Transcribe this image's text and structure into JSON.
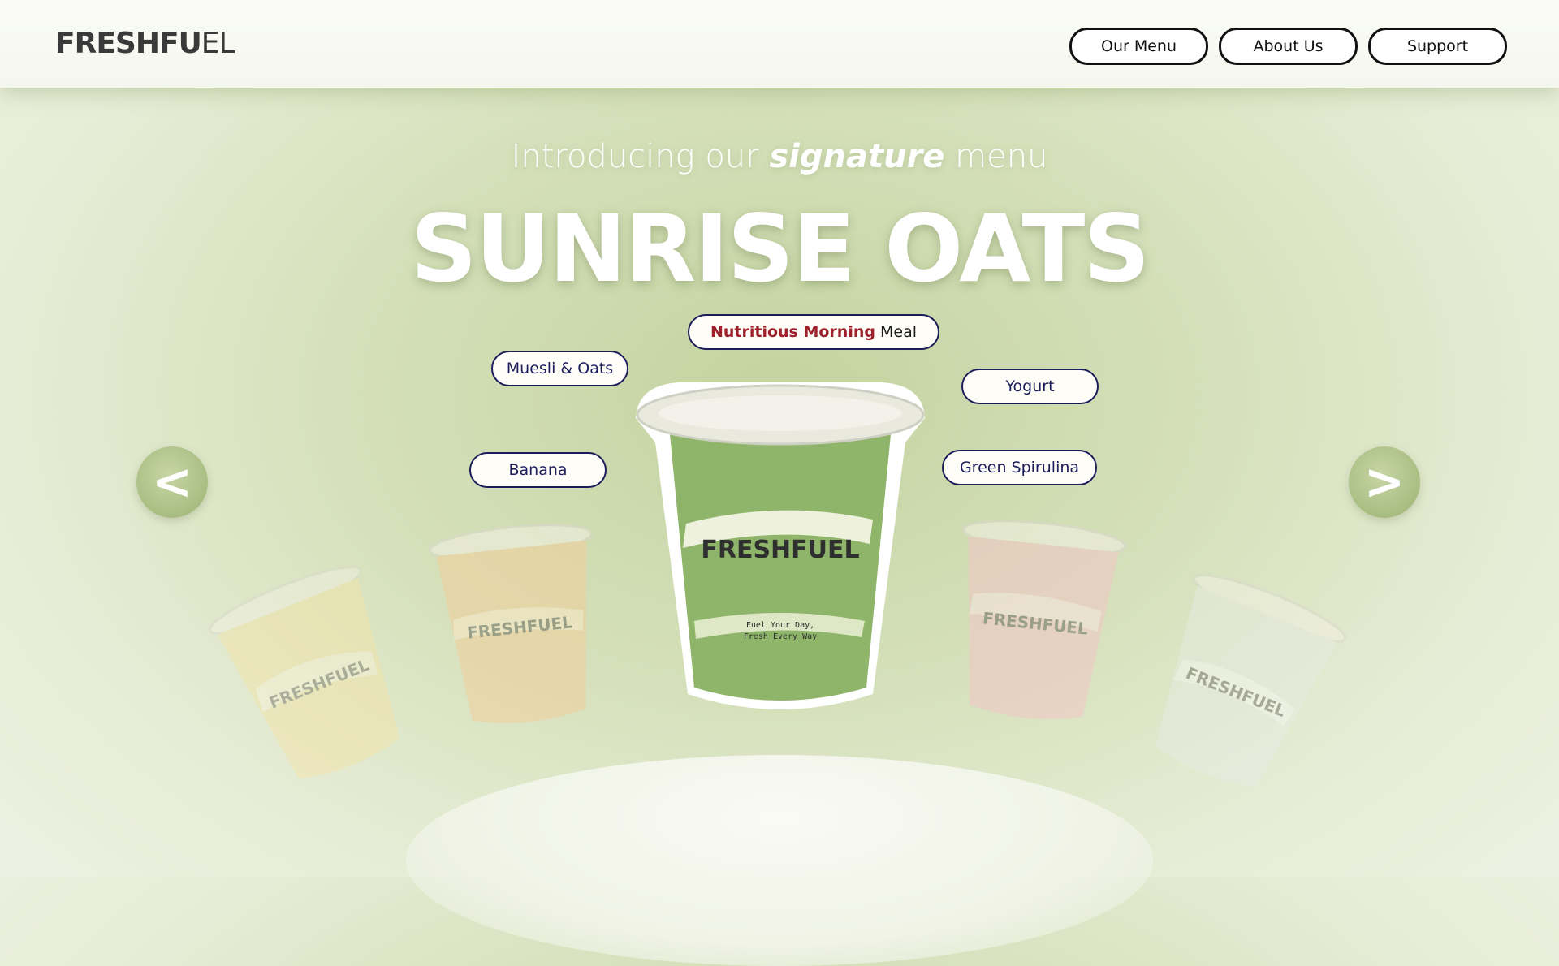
{
  "brand": {
    "logo_bold": "FRESHF",
    "logo_glyph": "U",
    "logo_rest": "EL"
  },
  "nav": {
    "items": [
      {
        "label": "Our Menu"
      },
      {
        "label": "About Us"
      },
      {
        "label": "Support"
      }
    ]
  },
  "hero": {
    "intro_pre": "Introducing our ",
    "intro_em": "signature",
    "intro_post": " menu",
    "title": "SUNRISE OATS"
  },
  "tags": {
    "headline_hl": "Nutritious Morning",
    "headline_rest": "Meal",
    "muesli": "Muesli & Oats",
    "yogurt": "Yogurt",
    "banana": "Banana",
    "spirulina": "Green Spirulina"
  },
  "carousel": {
    "prev_label": "<",
    "next_label": ">",
    "cups": [
      {
        "name": "yellow-smoothie",
        "color": "#f5e3a6",
        "cup_text": "FRESHFUEL"
      },
      {
        "name": "orange-smoothie",
        "color": "#f3cf9c",
        "cup_text": "FRESHFUEL"
      },
      {
        "name": "green-smoothie",
        "color": "#8fb56a",
        "cup_text": "FRESHFUEL",
        "slogan_1": "Fuel Your Day,",
        "slogan_2": "Fresh Every Way"
      },
      {
        "name": "pink-smoothie",
        "color": "#f3c6c6",
        "cup_text": "FRESHFUEL"
      },
      {
        "name": "white-smoothie",
        "color": "#e8eae3",
        "cup_text": "FRESHFUEL"
      }
    ]
  },
  "colors": {
    "accent_red": "#9c1f2a",
    "tag_border": "#1b1d5a",
    "arrow_green": "#a9bd82"
  }
}
